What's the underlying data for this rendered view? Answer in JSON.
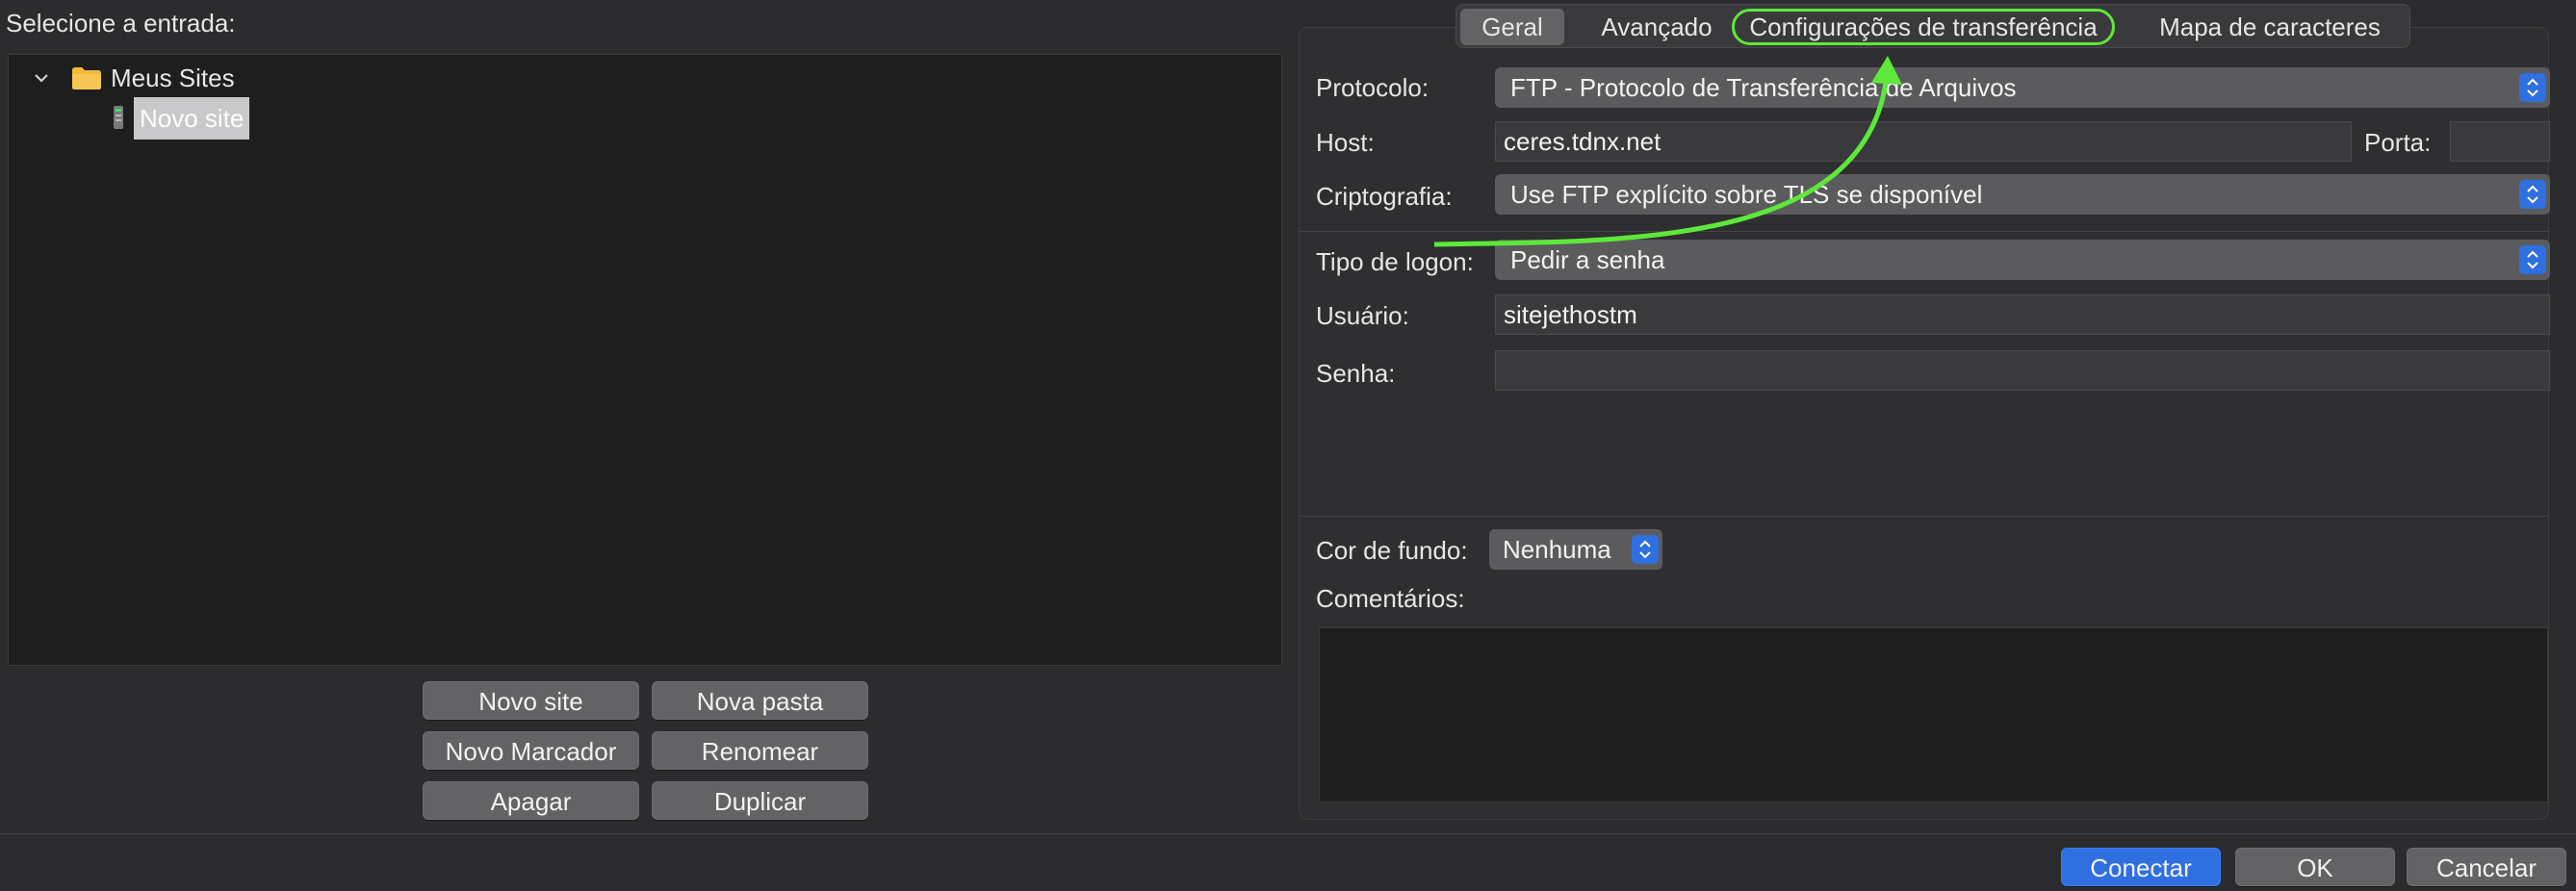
{
  "left": {
    "prompt_label": "Selecione a entrada:",
    "tree": {
      "root_label": "Meus Sites",
      "child_label": "Novo site"
    },
    "buttons": {
      "new_site": "Novo site",
      "new_folder": "Nova pasta",
      "new_bookmark": "Novo Marcador",
      "rename": "Renomear",
      "delete": "Apagar",
      "duplicate": "Duplicar"
    }
  },
  "tabs": {
    "general": "Geral",
    "advanced": "Avançado",
    "transfer": "Configurações de transferência",
    "charset": "Mapa de caracteres"
  },
  "form": {
    "protocol_label": "Protocolo:",
    "protocol_value": "FTP - Protocolo de Transferência de Arquivos",
    "host_label": "Host:",
    "host_value": "ceres.tdnx.net",
    "port_label": "Porta:",
    "port_value": "",
    "encryption_label": "Criptografia:",
    "encryption_value": "Use FTP explícito sobre TLS se disponível",
    "logon_label": "Tipo de logon:",
    "logon_value": "Pedir a senha",
    "user_label": "Usuário:",
    "user_value": "sitejethostm",
    "password_label": "Senha:",
    "password_value": "",
    "bgcolor_label": "Cor de fundo:",
    "bgcolor_value": "Nenhuma",
    "comments_label": "Comentários:"
  },
  "footer": {
    "connect": "Conectar",
    "ok": "OK",
    "cancel": "Cancelar"
  },
  "colors": {
    "accent": "#2f6fe0",
    "annotation": "#5ee83a"
  }
}
